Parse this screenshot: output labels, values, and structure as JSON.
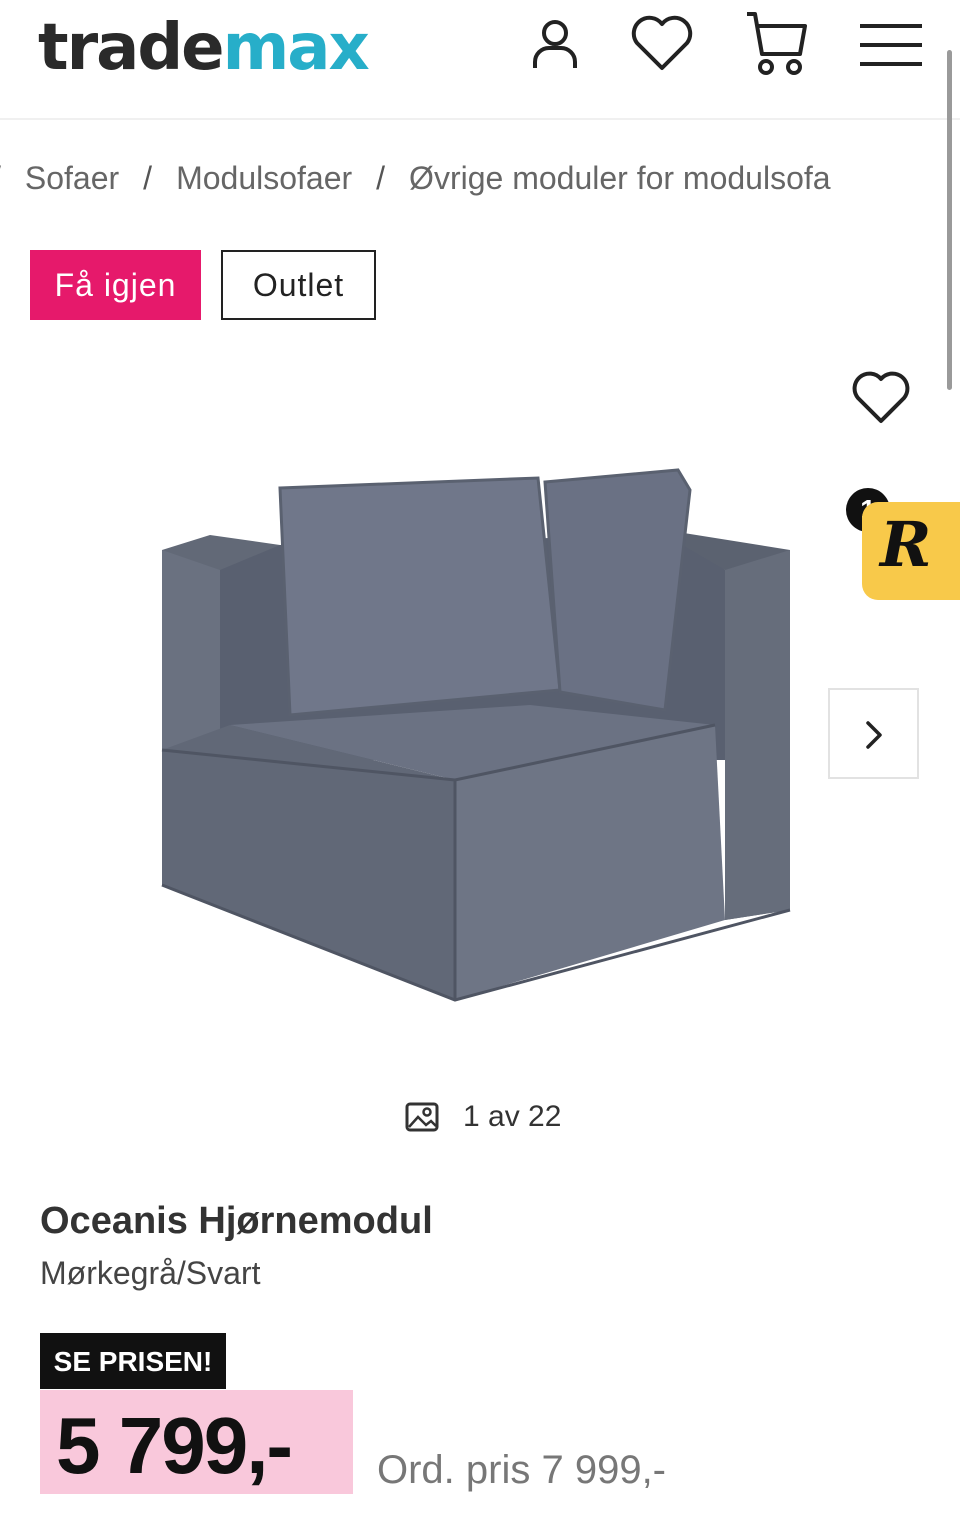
{
  "header": {
    "logo_part1": "trade",
    "logo_part2": "max",
    "icons": [
      "user-icon",
      "heart-icon",
      "cart-icon",
      "menu-icon"
    ]
  },
  "breadcrumb": {
    "separator": "/",
    "items": [
      "Sofaer",
      "Modulsofaer",
      "Øvrige moduler for modulsofa"
    ]
  },
  "tags": {
    "restock": "Få igjen",
    "outlet": "Outlet"
  },
  "gallery": {
    "counter": "1 av 22"
  },
  "rbadge": {
    "letter": "R",
    "count": "1"
  },
  "product": {
    "title": "Oceanis Hjørnemodul",
    "variant": "Mørkegrå/Svart",
    "promo_badge": "SE PRISEN!",
    "price": "5 799,-",
    "ordinary_price": "Ord. pris 7 999,-"
  },
  "colors": {
    "brand_dark": "#2a2a2a",
    "brand_accent": "#27aec9",
    "tag_pink": "#e6196b",
    "price_bg": "#f9c8db",
    "badge_yellow": "#f8c94a"
  }
}
